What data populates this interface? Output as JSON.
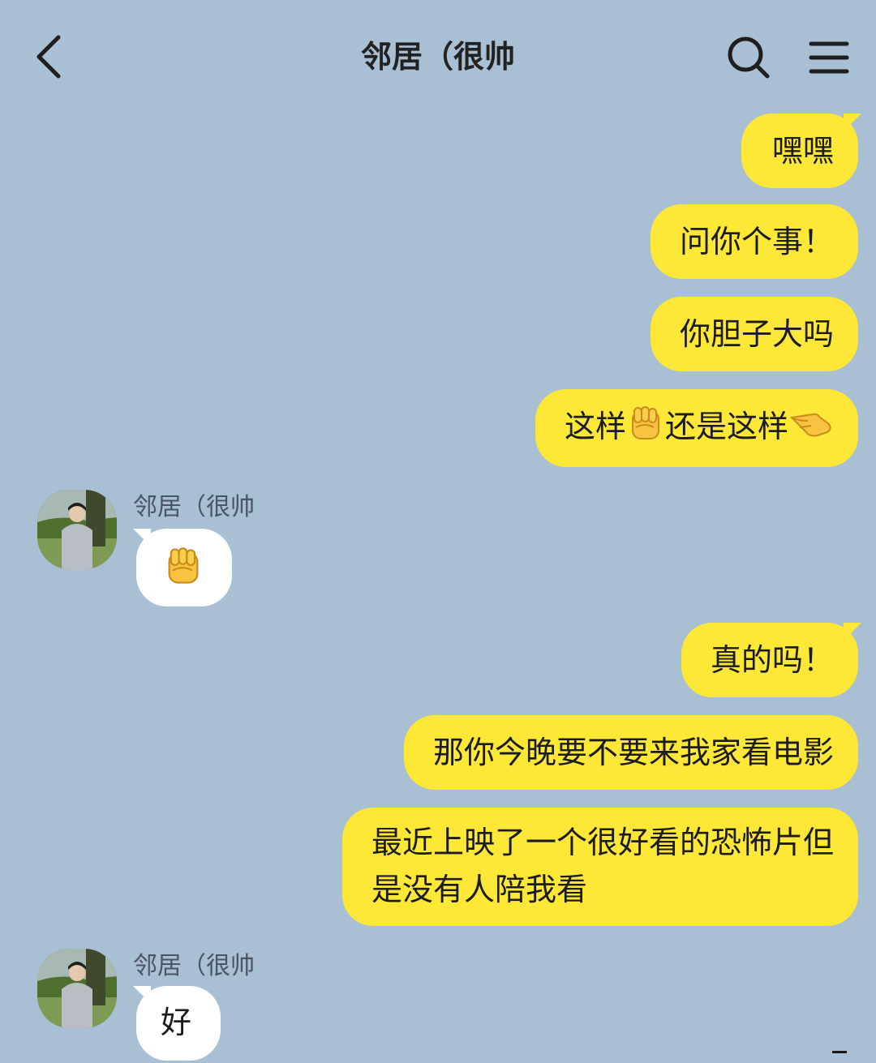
{
  "header": {
    "title": "邻居（很帅",
    "back_icon": "chevron-left-icon",
    "search_icon": "search-icon",
    "menu_icon": "hamburger-menu-icon"
  },
  "colors": {
    "background": "#a9bfd3",
    "sent_bubble": "#fde838",
    "received_bubble": "#ffffff"
  },
  "contact": {
    "name": "邻居（很帅"
  },
  "messages": [
    {
      "side": "sent",
      "text": "嘿嘿"
    },
    {
      "side": "sent",
      "text": "问你个事！"
    },
    {
      "side": "sent",
      "text": "你胆子大吗"
    },
    {
      "side": "sent",
      "text_before": "这样",
      "emoji_1": "raised-fist-icon",
      "text_middle": "还是这样",
      "emoji_2": "pinching-hand-icon"
    },
    {
      "side": "received",
      "sender": "邻居（很帅",
      "emoji": "raised-fist-icon"
    },
    {
      "side": "sent",
      "text": "真的吗！"
    },
    {
      "side": "sent",
      "text": "那你今晚要不要来我家看电影"
    },
    {
      "side": "sent",
      "line1": "最近上映了一个很好看的恐怖片但",
      "line2": "是没有人陪我看"
    },
    {
      "side": "received",
      "sender": "邻居（很帅",
      "text": "好"
    }
  ]
}
